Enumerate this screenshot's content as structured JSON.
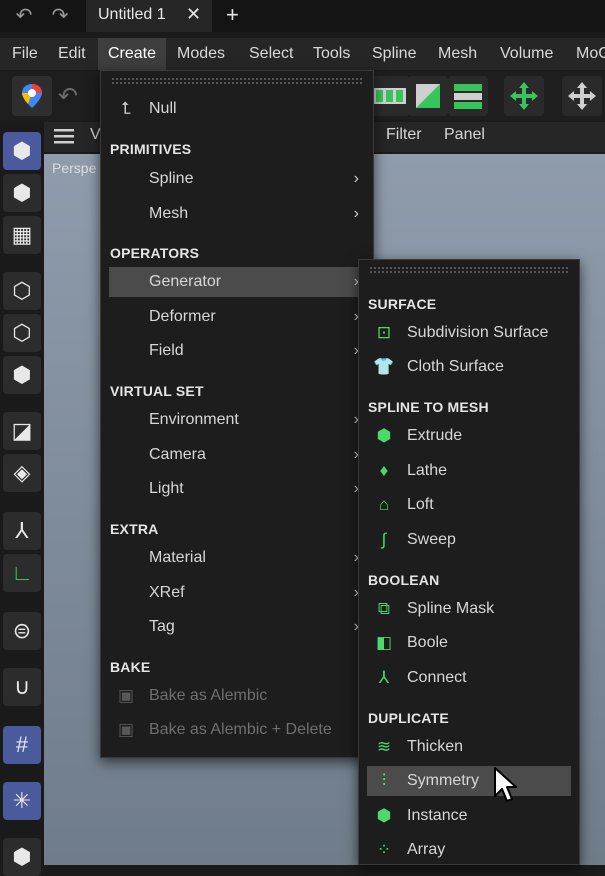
{
  "titlebar": {
    "tab_title": "Untitled 1",
    "close_glyph": "✕",
    "new_tab_glyph": "+",
    "undo_icon": "undo-icon",
    "redo_icon": "redo-icon"
  },
  "menubar": {
    "items": [
      "File",
      "Edit",
      "Create",
      "Modes",
      "Select",
      "Tools",
      "Spline",
      "Mesh",
      "Volume",
      "MoG"
    ],
    "active": "Create"
  },
  "viewport": {
    "header_menu_first": "V",
    "filter": "Filter",
    "panel": "Panel",
    "camera_label": "Perspe"
  },
  "create_menu": {
    "null_label": "Null",
    "sections": {
      "primitives": "PRIMITIVES",
      "operators": "OPERATORS",
      "virtual_set": "VIRTUAL SET",
      "extra": "EXTRA",
      "bake": "BAKE"
    },
    "primitives": [
      "Spline",
      "Mesh"
    ],
    "operators": [
      "Generator",
      "Deformer",
      "Field"
    ],
    "virtual_set": [
      "Environment",
      "Camera",
      "Light"
    ],
    "extra": [
      "Material",
      "XRef",
      "Tag"
    ],
    "bake": [
      "Bake as Alembic",
      "Bake as Alembic + Delete"
    ],
    "highlighted": "Generator",
    "arrow": "›"
  },
  "generator_menu": {
    "sections": {
      "surface": "SURFACE",
      "spline_to_mesh": "SPLINE TO MESH",
      "boolean": "BOOLEAN",
      "duplicate": "DUPLICATE"
    },
    "surface": [
      "Subdivision Surface",
      "Cloth Surface"
    ],
    "spline_to_mesh": [
      "Extrude",
      "Lathe",
      "Loft",
      "Sweep"
    ],
    "boolean": [
      "Spline Mask",
      "Boole",
      "Connect"
    ],
    "duplicate": [
      "Thicken",
      "Symmetry",
      "Instance",
      "Array"
    ],
    "highlighted": "Symmetry",
    "accent_color": "#4cd86a"
  }
}
